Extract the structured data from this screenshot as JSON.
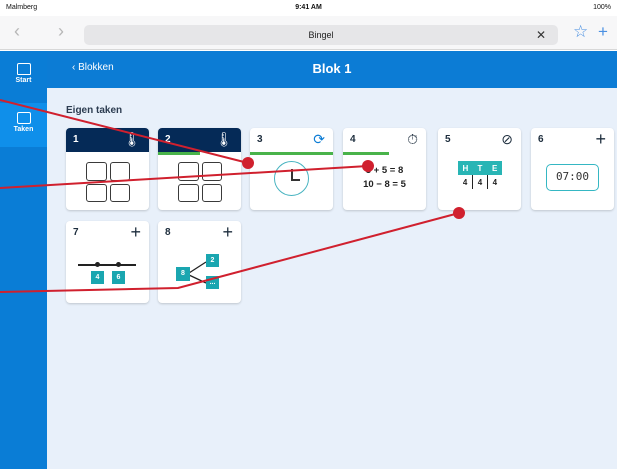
{
  "status": {
    "carrier": "Malmberg",
    "time": "9:41 AM",
    "battery": "100%"
  },
  "browser": {
    "url": "Bingel",
    "clear_glyph": "✕",
    "back_glyph": "‹",
    "forward_glyph": "›",
    "bookmark_icon": "star-icon",
    "add_icon": "plus-icon"
  },
  "sidebar": {
    "items": [
      {
        "label": "Start",
        "icon": "home-icon"
      },
      {
        "label": "Taken",
        "icon": "tasks-icon",
        "active": true
      }
    ]
  },
  "header": {
    "back_label": "‹  Blokken",
    "title": "Blok 1"
  },
  "section_title": "Eigen taken",
  "tasks": [
    {
      "number": "1",
      "icon": "thermometer-icon",
      "header_style": "dark",
      "progress": 0
    },
    {
      "number": "2",
      "icon": "thermometer-icon",
      "header_style": "dark",
      "progress": 0.5
    },
    {
      "number": "3",
      "icon": "refresh-icon",
      "header_style": "light",
      "progress": 1
    },
    {
      "number": "4",
      "icon": "stopwatch-icon",
      "header_style": "light",
      "progress": 0.6
    },
    {
      "number": "5",
      "icon": "check-cycle-icon",
      "header_style": "light",
      "progress": 0
    },
    {
      "number": "6",
      "icon": "plus-icon",
      "header_style": "light",
      "progress": 0
    },
    {
      "number": "7",
      "icon": "plus-icon",
      "header_style": "light",
      "progress": 0
    },
    {
      "number": "8",
      "icon": "plus-icon",
      "header_style": "light",
      "progress": 0
    }
  ],
  "card_content": {
    "sum1": "3 + 5 = 8",
    "sum2": "10 − 8 = 5",
    "hte_head": [
      "H",
      "T",
      "E"
    ],
    "hte_vals": [
      "4",
      "4",
      "4"
    ],
    "digital_time": "07:00",
    "tape_left": "4",
    "tape_right": "6",
    "split_total": "8",
    "split_part": "2",
    "split_unknown": "..."
  },
  "icon_glyphs": {
    "thermometer": "🌡",
    "refresh": "⟳",
    "stopwatch": "⏱",
    "check_cycle": "⊘",
    "plus": "+"
  },
  "colors": {
    "primary": "#0c7cd5",
    "dark_header": "#052a57",
    "progress": "#49b34a",
    "teal": "#1aa6b0",
    "annotation": "#d0202e"
  }
}
